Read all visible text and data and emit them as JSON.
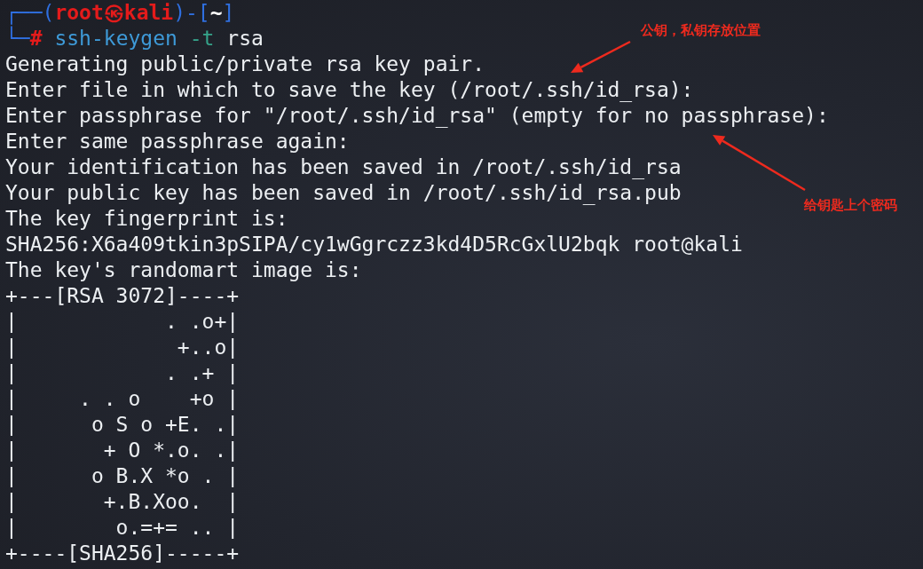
{
  "terminal": {
    "prompt": [
      [
        {
          "kind": "frame",
          "text": "┌──("
        },
        {
          "kind": "user",
          "text": "root㉿kali"
        },
        {
          "kind": "frame",
          "text": ")-["
        },
        {
          "kind": "cwd",
          "text": "~"
        },
        {
          "kind": "frame",
          "text": "]"
        }
      ],
      [
        {
          "kind": "frame",
          "text": "└─"
        },
        {
          "kind": "symbol",
          "text": "#"
        },
        {
          "kind": "command",
          "text": " ssh-keygen"
        },
        {
          "kind": "option",
          "text": " -t"
        },
        {
          "kind": "arg",
          "text": " rsa"
        }
      ]
    ],
    "output": [
      "Generating public/private rsa key pair.",
      "Enter file in which to save the key (/root/.ssh/id_rsa):",
      "Enter passphrase for \"/root/.ssh/id_rsa\" (empty for no passphrase):",
      "Enter same passphrase again:",
      "Your identification has been saved in /root/.ssh/id_rsa",
      "Your public key has been saved in /root/.ssh/id_rsa.pub",
      "The key fingerprint is:",
      "SHA256:X6a409tkin3pSIPA/cy1wGgrczz3kd4D5RcGxlU2bqk root@kali",
      "The key's randomart image is:"
    ],
    "randomart": [
      "+---[RSA 3072]----+",
      "|            . .o+|",
      "|             +..o|",
      "|            . .+ |",
      "|     . . o    +o |",
      "|      o S o +E. .|",
      "|       + O *.o. .|",
      "|      o B.X *o . |",
      "|       +.B.Xoo.  |",
      "|        o.=+= .. |",
      "+----[SHA256]-----+"
    ]
  },
  "annotations": [
    {
      "text": "公钥，私钥存放位置"
    },
    {
      "text": "给钥匙上个密码"
    }
  ]
}
